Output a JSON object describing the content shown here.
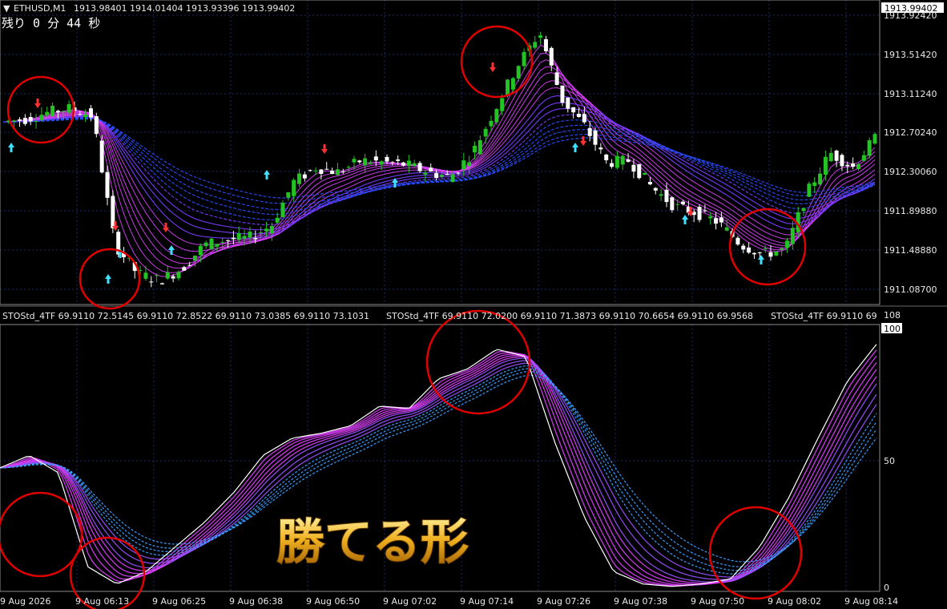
{
  "window": {
    "symbol_label": "ETHUSD,M1",
    "ohlc": "1913.98401 1914.01404 1913.93396 1913.99402",
    "countdown": "残り 0 分 44 秒",
    "current_price": "1913.99402"
  },
  "price_axis": [
    "1913.92420",
    "1913.51420",
    "1913.11240",
    "1912.70240",
    "1912.30060",
    "1911.89880",
    "1911.48880",
    "1911.08700"
  ],
  "indicator_header": [
    "STOStd_4TF 69.9110 72.5145 69.9110 72.8522 69.9110 73.0385 69.9110 73.1031",
    "STOStd_4TF 69.9110 72.0200 69.9110 71.3873 69.9110 70.6654 69.9110 69.9568",
    "STOStd_4TF 69.9110 69"
  ],
  "indicator_axis": {
    "top": "108",
    "current": "100",
    "mid": "50",
    "bottom": "0"
  },
  "time_axis": [
    "9 Aug 2026",
    "9 Aug 06:13",
    "9 Aug 06:25",
    "9 Aug 06:38",
    "9 Aug 06:50",
    "9 Aug 07:02",
    "9 Aug 07:14",
    "9 Aug 07:26",
    "9 Aug 07:38",
    "9 Aug 07:50",
    "9 Aug 08:02",
    "9 Aug 08:14"
  ],
  "overlay_text": "勝てる形",
  "colors": {
    "background": "#000000",
    "bull_candle": "#22c322",
    "bear_candle": "#ffffff",
    "ribbon_magenta": "#e040ff",
    "ribbon_blue": "#2a4dff",
    "arrow_up": "#40e0ff",
    "arrow_down": "#ff3030",
    "circle": "#e00000",
    "gold": "#f0b020"
  },
  "chart_data": {
    "type": "candlestick",
    "price_path": [
      1912.82,
      1912.85,
      1912.92,
      1912.96,
      1912.88,
      1911.55,
      1911.25,
      1911.18,
      1911.3,
      1911.55,
      1911.6,
      1911.62,
      1911.75,
      1912.2,
      1912.35,
      1912.3,
      1912.42,
      1912.4,
      1912.38,
      1912.3,
      1912.25,
      1912.5,
      1912.95,
      1913.4,
      1913.75,
      1913.05,
      1912.78,
      1912.4,
      1912.42,
      1912.15,
      1911.95,
      1911.88,
      1911.78,
      1911.55,
      1911.45,
      1911.5,
      1912.1,
      1912.5,
      1912.35,
      1912.65
    ],
    "stoch_path": [
      50,
      55,
      48,
      10,
      3,
      8,
      18,
      28,
      40,
      55,
      62,
      64,
      67,
      75,
      74,
      86,
      90,
      98,
      95,
      60,
      30,
      8,
      3,
      2,
      3,
      5,
      18,
      38,
      62,
      85,
      100
    ],
    "stoch_range": [
      0,
      108
    ]
  }
}
